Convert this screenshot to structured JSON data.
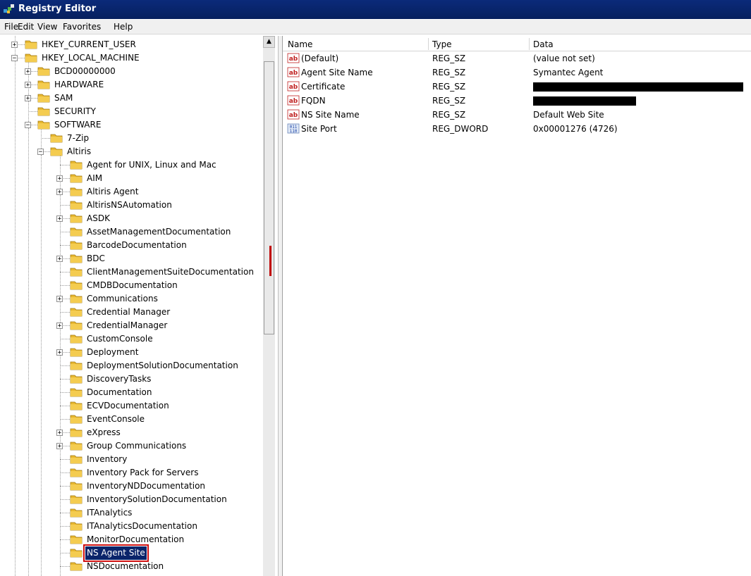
{
  "window": {
    "title": "Registry Editor"
  },
  "menu": [
    "File",
    "Edit",
    "View",
    "Favorites",
    "Help"
  ],
  "tree": {
    "nodes": [
      {
        "label": "HKEY_CURRENT_USER",
        "level": 0,
        "toggle": "plus"
      },
      {
        "label": "HKEY_LOCAL_MACHINE",
        "level": 0,
        "toggle": "minus"
      },
      {
        "label": "BCD00000000",
        "level": 1,
        "toggle": "plus"
      },
      {
        "label": "HARDWARE",
        "level": 1,
        "toggle": "plus"
      },
      {
        "label": "SAM",
        "level": 1,
        "toggle": "plus"
      },
      {
        "label": "SECURITY",
        "level": 1,
        "toggle": "none"
      },
      {
        "label": "SOFTWARE",
        "level": 1,
        "toggle": "minus"
      },
      {
        "label": "7-Zip",
        "level": 2,
        "toggle": "none"
      },
      {
        "label": "Altiris",
        "level": 2,
        "toggle": "minus"
      },
      {
        "label": "Agent for UNIX, Linux and Mac",
        "level": 3,
        "toggle": "none"
      },
      {
        "label": "AIM",
        "level": 3,
        "toggle": "plus"
      },
      {
        "label": "Altiris Agent",
        "level": 3,
        "toggle": "plus"
      },
      {
        "label": "AltirisNSAutomation",
        "level": 3,
        "toggle": "none"
      },
      {
        "label": "ASDK",
        "level": 3,
        "toggle": "plus"
      },
      {
        "label": "AssetManagementDocumentation",
        "level": 3,
        "toggle": "none"
      },
      {
        "label": "BarcodeDocumentation",
        "level": 3,
        "toggle": "none"
      },
      {
        "label": "BDC",
        "level": 3,
        "toggle": "plus"
      },
      {
        "label": "ClientManagementSuiteDocumentation",
        "level": 3,
        "toggle": "none"
      },
      {
        "label": "CMDBDocumentation",
        "level": 3,
        "toggle": "none"
      },
      {
        "label": "Communications",
        "level": 3,
        "toggle": "plus"
      },
      {
        "label": "Credential Manager",
        "level": 3,
        "toggle": "none"
      },
      {
        "label": "CredentialManager",
        "level": 3,
        "toggle": "plus"
      },
      {
        "label": "CustomConsole",
        "level": 3,
        "toggle": "none"
      },
      {
        "label": "Deployment",
        "level": 3,
        "toggle": "plus"
      },
      {
        "label": "DeploymentSolutionDocumentation",
        "level": 3,
        "toggle": "none"
      },
      {
        "label": "DiscoveryTasks",
        "level": 3,
        "toggle": "none"
      },
      {
        "label": "Documentation",
        "level": 3,
        "toggle": "none"
      },
      {
        "label": "ECVDocumentation",
        "level": 3,
        "toggle": "none"
      },
      {
        "label": "EventConsole",
        "level": 3,
        "toggle": "none"
      },
      {
        "label": "eXpress",
        "level": 3,
        "toggle": "plus"
      },
      {
        "label": "Group Communications",
        "level": 3,
        "toggle": "plus"
      },
      {
        "label": "Inventory",
        "level": 3,
        "toggle": "none"
      },
      {
        "label": "Inventory Pack for Servers",
        "level": 3,
        "toggle": "none"
      },
      {
        "label": "InventoryNDDocumentation",
        "level": 3,
        "toggle": "none"
      },
      {
        "label": "InventorySolutionDocumentation",
        "level": 3,
        "toggle": "none"
      },
      {
        "label": "ITAnalytics",
        "level": 3,
        "toggle": "none"
      },
      {
        "label": "ITAnalyticsDocumentation",
        "level": 3,
        "toggle": "none"
      },
      {
        "label": "MonitorDocumentation",
        "level": 3,
        "toggle": "none"
      },
      {
        "label": "NS Agent Site",
        "level": 3,
        "toggle": "none",
        "selected": true
      },
      {
        "label": "NSDocumentation",
        "level": 3,
        "toggle": "none"
      }
    ]
  },
  "list": {
    "columns": {
      "name": "Name",
      "type": "Type",
      "data": "Data"
    },
    "rows": [
      {
        "name": "(Default)",
        "type": "REG_SZ",
        "data": "(value not set)",
        "icon": "string-value-icon"
      },
      {
        "name": "Agent Site Name",
        "type": "REG_SZ",
        "data": "Symantec Agent",
        "icon": "string-value-icon"
      },
      {
        "name": "Certificate",
        "type": "REG_SZ",
        "data": "",
        "redacted": true,
        "icon": "string-value-icon"
      },
      {
        "name": "FQDN",
        "type": "REG_SZ",
        "data": "",
        "redacted": true,
        "icon": "string-value-icon"
      },
      {
        "name": "NS Site Name",
        "type": "REG_SZ",
        "data": "Default Web Site",
        "icon": "string-value-icon"
      },
      {
        "name": "Site Port",
        "type": "REG_DWORD",
        "data": "0x00001276 (4726)",
        "icon": "dword-value-icon"
      }
    ]
  },
  "colors": {
    "titlebar": "#0b2a7a",
    "selection": "#0a246a",
    "highlight_box": "#d01010",
    "scroll_marker": "#c00000"
  }
}
